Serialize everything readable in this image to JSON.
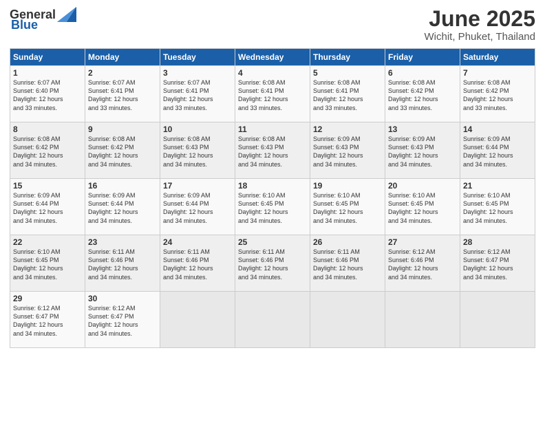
{
  "logo": {
    "text_general": "General",
    "text_blue": "Blue"
  },
  "title": "June 2025",
  "subtitle": "Wichit, Phuket, Thailand",
  "headers": [
    "Sunday",
    "Monday",
    "Tuesday",
    "Wednesday",
    "Thursday",
    "Friday",
    "Saturday"
  ],
  "weeks": [
    [
      {
        "day": "1",
        "sunrise": "Sunrise: 6:07 AM",
        "sunset": "Sunset: 6:40 PM",
        "daylight": "Daylight: 12 hours and 33 minutes."
      },
      {
        "day": "2",
        "sunrise": "Sunrise: 6:07 AM",
        "sunset": "Sunset: 6:41 PM",
        "daylight": "Daylight: 12 hours and 33 minutes."
      },
      {
        "day": "3",
        "sunrise": "Sunrise: 6:07 AM",
        "sunset": "Sunset: 6:41 PM",
        "daylight": "Daylight: 12 hours and 33 minutes."
      },
      {
        "day": "4",
        "sunrise": "Sunrise: 6:08 AM",
        "sunset": "Sunset: 6:41 PM",
        "daylight": "Daylight: 12 hours and 33 minutes."
      },
      {
        "day": "5",
        "sunrise": "Sunrise: 6:08 AM",
        "sunset": "Sunset: 6:41 PM",
        "daylight": "Daylight: 12 hours and 33 minutes."
      },
      {
        "day": "6",
        "sunrise": "Sunrise: 6:08 AM",
        "sunset": "Sunset: 6:42 PM",
        "daylight": "Daylight: 12 hours and 33 minutes."
      },
      {
        "day": "7",
        "sunrise": "Sunrise: 6:08 AM",
        "sunset": "Sunset: 6:42 PM",
        "daylight": "Daylight: 12 hours and 33 minutes."
      }
    ],
    [
      {
        "day": "8",
        "sunrise": "Sunrise: 6:08 AM",
        "sunset": "Sunset: 6:42 PM",
        "daylight": "Daylight: 12 hours and 34 minutes."
      },
      {
        "day": "9",
        "sunrise": "Sunrise: 6:08 AM",
        "sunset": "Sunset: 6:42 PM",
        "daylight": "Daylight: 12 hours and 34 minutes."
      },
      {
        "day": "10",
        "sunrise": "Sunrise: 6:08 AM",
        "sunset": "Sunset: 6:43 PM",
        "daylight": "Daylight: 12 hours and 34 minutes."
      },
      {
        "day": "11",
        "sunrise": "Sunrise: 6:08 AM",
        "sunset": "Sunset: 6:43 PM",
        "daylight": "Daylight: 12 hours and 34 minutes."
      },
      {
        "day": "12",
        "sunrise": "Sunrise: 6:09 AM",
        "sunset": "Sunset: 6:43 PM",
        "daylight": "Daylight: 12 hours and 34 minutes."
      },
      {
        "day": "13",
        "sunrise": "Sunrise: 6:09 AM",
        "sunset": "Sunset: 6:43 PM",
        "daylight": "Daylight: 12 hours and 34 minutes."
      },
      {
        "day": "14",
        "sunrise": "Sunrise: 6:09 AM",
        "sunset": "Sunset: 6:44 PM",
        "daylight": "Daylight: 12 hours and 34 minutes."
      }
    ],
    [
      {
        "day": "15",
        "sunrise": "Sunrise: 6:09 AM",
        "sunset": "Sunset: 6:44 PM",
        "daylight": "Daylight: 12 hours and 34 minutes."
      },
      {
        "day": "16",
        "sunrise": "Sunrise: 6:09 AM",
        "sunset": "Sunset: 6:44 PM",
        "daylight": "Daylight: 12 hours and 34 minutes."
      },
      {
        "day": "17",
        "sunrise": "Sunrise: 6:09 AM",
        "sunset": "Sunset: 6:44 PM",
        "daylight": "Daylight: 12 hours and 34 minutes."
      },
      {
        "day": "18",
        "sunrise": "Sunrise: 6:10 AM",
        "sunset": "Sunset: 6:45 PM",
        "daylight": "Daylight: 12 hours and 34 minutes."
      },
      {
        "day": "19",
        "sunrise": "Sunrise: 6:10 AM",
        "sunset": "Sunset: 6:45 PM",
        "daylight": "Daylight: 12 hours and 34 minutes."
      },
      {
        "day": "20",
        "sunrise": "Sunrise: 6:10 AM",
        "sunset": "Sunset: 6:45 PM",
        "daylight": "Daylight: 12 hours and 34 minutes."
      },
      {
        "day": "21",
        "sunrise": "Sunrise: 6:10 AM",
        "sunset": "Sunset: 6:45 PM",
        "daylight": "Daylight: 12 hours and 34 minutes."
      }
    ],
    [
      {
        "day": "22",
        "sunrise": "Sunrise: 6:10 AM",
        "sunset": "Sunset: 6:45 PM",
        "daylight": "Daylight: 12 hours and 34 minutes."
      },
      {
        "day": "23",
        "sunrise": "Sunrise: 6:11 AM",
        "sunset": "Sunset: 6:46 PM",
        "daylight": "Daylight: 12 hours and 34 minutes."
      },
      {
        "day": "24",
        "sunrise": "Sunrise: 6:11 AM",
        "sunset": "Sunset: 6:46 PM",
        "daylight": "Daylight: 12 hours and 34 minutes."
      },
      {
        "day": "25",
        "sunrise": "Sunrise: 6:11 AM",
        "sunset": "Sunset: 6:46 PM",
        "daylight": "Daylight: 12 hours and 34 minutes."
      },
      {
        "day": "26",
        "sunrise": "Sunrise: 6:11 AM",
        "sunset": "Sunset: 6:46 PM",
        "daylight": "Daylight: 12 hours and 34 minutes."
      },
      {
        "day": "27",
        "sunrise": "Sunrise: 6:12 AM",
        "sunset": "Sunset: 6:46 PM",
        "daylight": "Daylight: 12 hours and 34 minutes."
      },
      {
        "day": "28",
        "sunrise": "Sunrise: 6:12 AM",
        "sunset": "Sunset: 6:47 PM",
        "daylight": "Daylight: 12 hours and 34 minutes."
      }
    ],
    [
      {
        "day": "29",
        "sunrise": "Sunrise: 6:12 AM",
        "sunset": "Sunset: 6:47 PM",
        "daylight": "Daylight: 12 hours and 34 minutes."
      },
      {
        "day": "30",
        "sunrise": "Sunrise: 6:12 AM",
        "sunset": "Sunset: 6:47 PM",
        "daylight": "Daylight: 12 hours and 34 minutes."
      },
      null,
      null,
      null,
      null,
      null
    ]
  ]
}
